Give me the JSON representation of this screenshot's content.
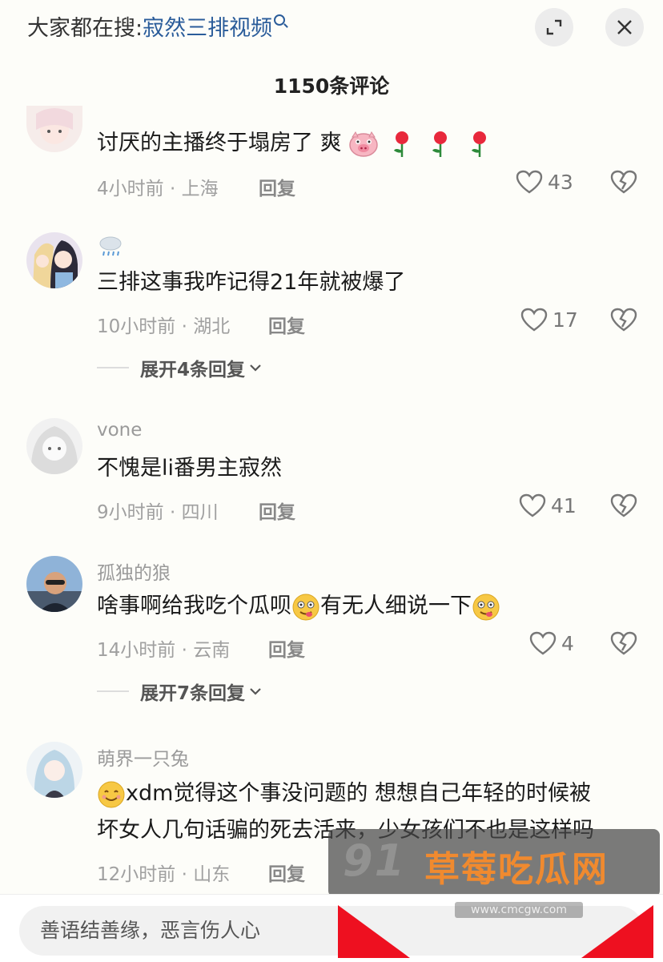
{
  "header": {
    "search_prefix": "大家都在搜:",
    "search_term": "寂然三排视频",
    "comment_count": "1150条评论"
  },
  "comments": [
    {
      "username": "",
      "text": "讨厌的主播终于塌房了 爽",
      "meta": "4小时前 · 上海",
      "reply": "回复",
      "likes": "43"
    },
    {
      "username": "",
      "text": "三排这事我咋记得21年就被爆了",
      "meta": "10小时前 · 湖北",
      "reply": "回复",
      "likes": "17",
      "expand": "展开4条回复"
    },
    {
      "username": "vone",
      "text": "不愧是li番男主寂然",
      "meta": "9小时前 · 四川",
      "reply": "回复",
      "likes": "41"
    },
    {
      "username": "孤独的狼",
      "text_a": "啥事啊给我吃个瓜呗",
      "text_b": "有无人细说一下",
      "meta": "14小时前 · 云南",
      "reply": "回复",
      "likes": "4",
      "expand": "展开7条回复"
    },
    {
      "username": "萌界一只兔",
      "text_line1": "xdm觉得这个事没问题的 想想自己年轻的时候被",
      "text_line2": "坏女人几句话骗的死去活来，少女孩们不也是这样吗",
      "meta": "12小时前 · 山东",
      "reply": "回复"
    }
  ],
  "input": {
    "placeholder": "善语结善缘，恶言伤人心"
  },
  "watermark": {
    "logo": "91",
    "brand": "草莓吃瓜网",
    "url": "www.cmcgw.com"
  },
  "colors": {
    "search_link": "#2a5c9a",
    "watermark_brand": "#f08a2f"
  }
}
